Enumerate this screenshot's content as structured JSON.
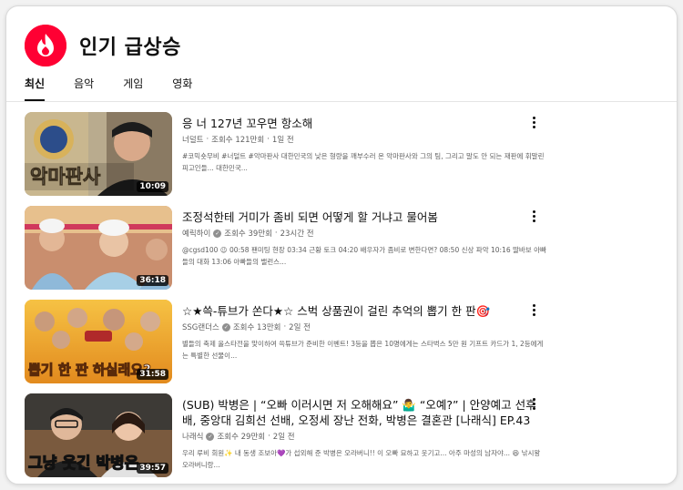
{
  "header": {
    "title": "인기 급상승",
    "logo_icon": "trending-flame-icon"
  },
  "tabs": [
    {
      "label": "최신",
      "active": true
    },
    {
      "label": "음악",
      "active": false
    },
    {
      "label": "게임",
      "active": false
    },
    {
      "label": "영화",
      "active": false
    }
  ],
  "videos": [
    {
      "title": "응 너 127년 꼬우면 항소해",
      "channel": "너덜트",
      "verified": false,
      "views": "조회수 121만회",
      "age": "1일 전",
      "description": "#코믹숏무비 #너덜트 #악마판사 대한민국의 낮은 형량을 깨부수러 온 악마판사와 그의 팀, 그리고 말도 안 되는 재판에 휘말린 피고인들... 대한민국...",
      "duration": "10:09",
      "thumb_text": "악마판사"
    },
    {
      "title": "조정석한테 거미가 좀비 되면 어떻게 할 거냐고 물어봄",
      "channel": "예릭하이",
      "verified": true,
      "views": "조회수 39만회",
      "age": "23시간 전",
      "description": "@cgsd100 😉 00:58 팬미팅 현장 03:34 근황 토크 04:20 배우자가 좀비로 변한다면? 08:50 신상 파악 10:16 딸바보 아빠들의 대화 13:06 아빠들의 밸런스...",
      "duration": "36:18",
      "thumb_text": ""
    },
    {
      "title": "☆★쓱-튜브가 쏜다★☆ 스벅 상품권이 걸린 추억의 뽑기 한 판🎯",
      "channel": "SSG랜더스",
      "verified": true,
      "views": "조회수 13만회",
      "age": "2일 전",
      "description": "별들의 축제 올스타전을 맞이하여 쓱튜브가 준비한 이벤트! 3등을 뽑은 10명에게는 스타벅스 5만 원 기프트 카드가 1, 2등에게는 특별한 선물이...",
      "duration": "31:58",
      "thumb_text": "뽑기 한 판 하실래요?"
    },
    {
      "title": "(SUB) 박병은 | “오빠 이러시면 저 오해해요” 🤷‍♂️ “오예?” | 안양예고 선후배, 중앙대 김희선 선배, 오정세 장난 전화, 박병은 결혼관 [나래식] EP.43",
      "channel": "나래식",
      "verified": true,
      "views": "조회수 29만회",
      "age": "2일 전",
      "description": "우리 루비 회원✨ 내 동생 조보아💜가 섭외해 준 박병은 오라버니!! 이 오빠 묘하고 웃기고... 아주 마성의 남자야... 😆 낚시왕 오라버니랑...",
      "duration": "39:57",
      "thumb_text": "그냥 웃긴 박병은"
    }
  ]
}
